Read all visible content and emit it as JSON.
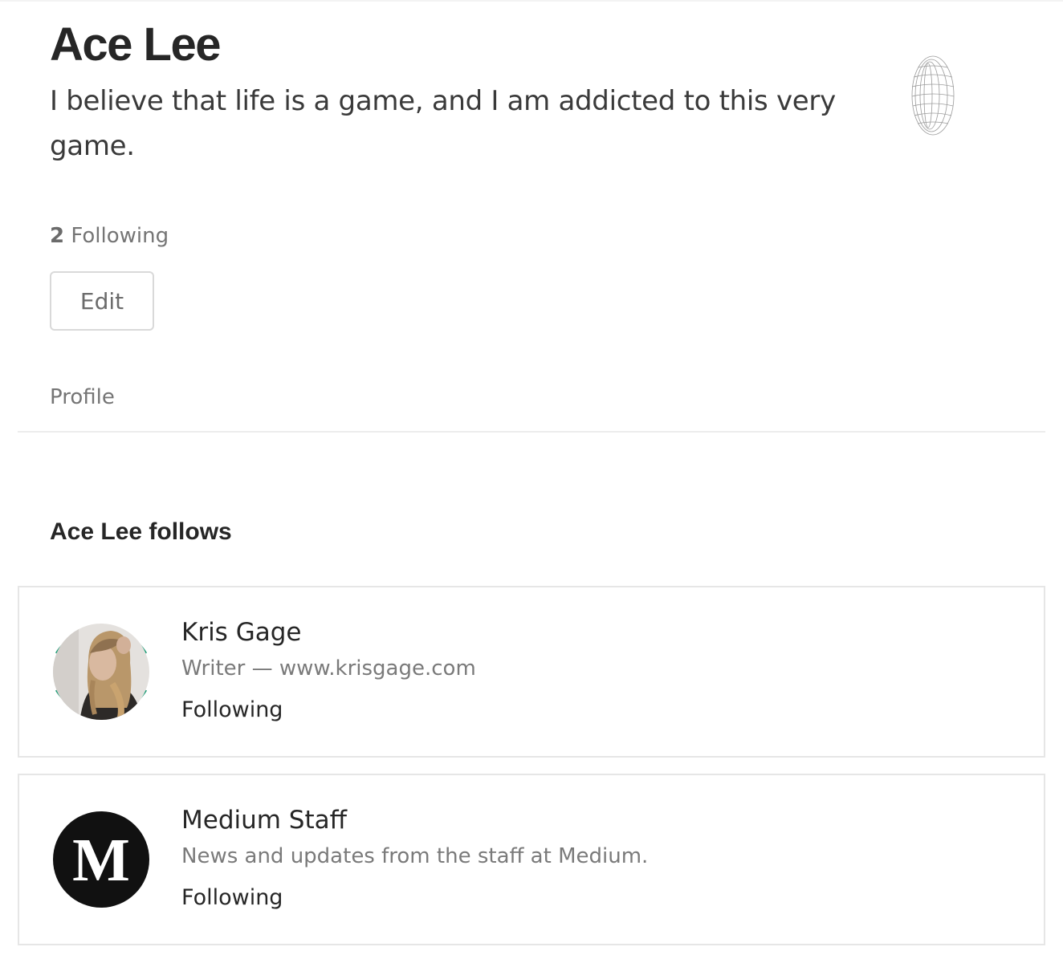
{
  "profile": {
    "name": "Ace Lee",
    "bio": "I believe that life is a game, and I am addicted to this very game.",
    "following_count": "2",
    "following_label": "Following",
    "edit_label": "Edit"
  },
  "tabs": [
    {
      "label": "Profile"
    }
  ],
  "follows": {
    "heading": "Ace Lee follows",
    "items": [
      {
        "name": "Kris Gage",
        "description": "Writer — www.krisgage.com",
        "status": "Following",
        "avatar_icon": "user-photo-avatar"
      },
      {
        "name": "Medium Staff",
        "description": "News and updates from the staff at Medium.",
        "status": "Following",
        "avatar_icon": "medium-m-logo",
        "avatar_letter": "M"
      }
    ]
  },
  "colors": {
    "ring_accent": "#1a9b75",
    "text_primary": "#262626",
    "text_secondary": "#757575",
    "border": "#e6e6e6"
  }
}
